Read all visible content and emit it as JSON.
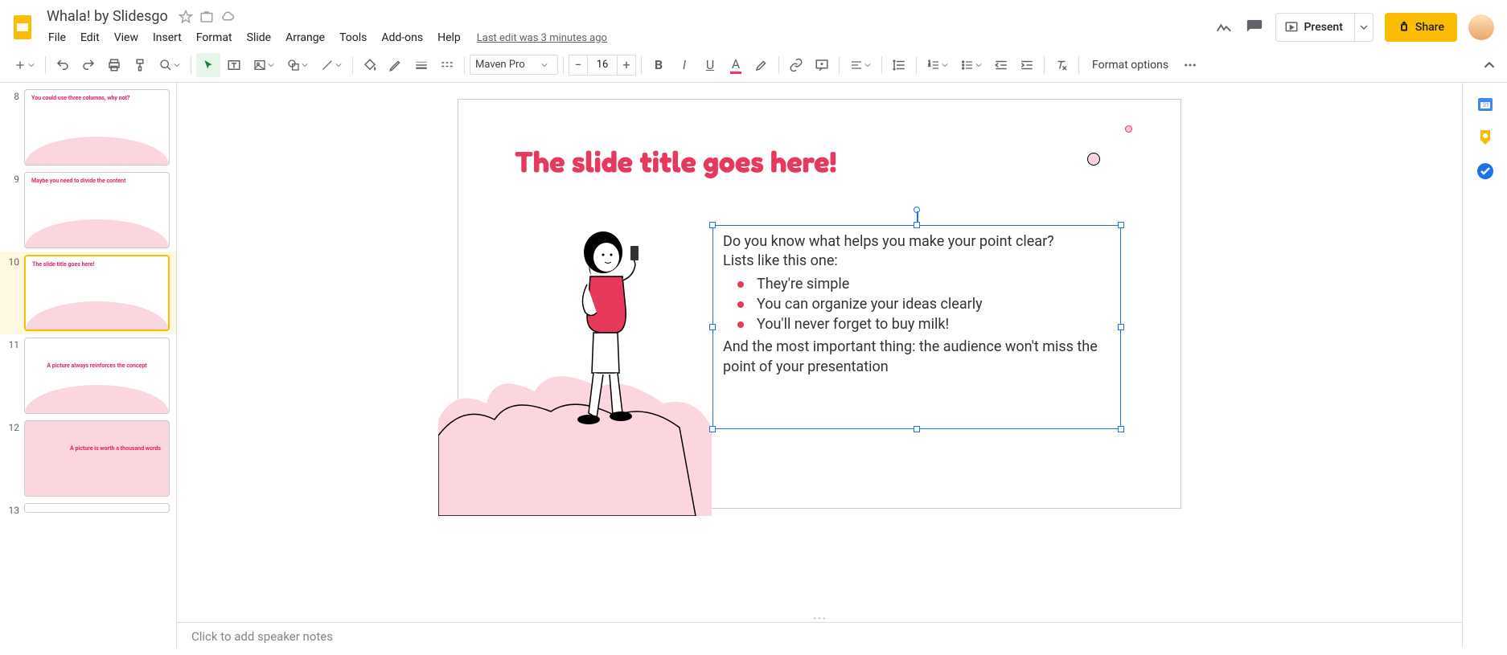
{
  "header": {
    "doc_title": "Whala! by Slidesgo",
    "last_edit": "Last edit was 3 minutes ago",
    "menus": [
      "File",
      "Edit",
      "View",
      "Insert",
      "Format",
      "Slide",
      "Arrange",
      "Tools",
      "Add-ons",
      "Help"
    ],
    "present_label": "Present",
    "share_label": "Share"
  },
  "toolbar": {
    "font_name": "Maven Pro",
    "font_size": "16",
    "format_options": "Format options"
  },
  "filmstrip": {
    "slides": [
      {
        "num": "8",
        "title": "You could use three columns, why not?"
      },
      {
        "num": "9",
        "title": "Maybe you need to divide the content"
      },
      {
        "num": "10",
        "title": "The slide title goes here!"
      },
      {
        "num": "11",
        "title": "A picture always reinforces the concept"
      },
      {
        "num": "12",
        "title": "A picture is worth a thousand words"
      },
      {
        "num": "13",
        "title": ""
      }
    ],
    "selected": 2
  },
  "slide": {
    "title": "The slide title goes here!",
    "body_intro1": "Do you know what helps you make your point clear?",
    "body_intro2": "Lists like this one:",
    "bullets": [
      "They're simple",
      "You can organize your ideas clearly",
      "You'll never forget to buy milk!"
    ],
    "body_outro": "And the most important thing: the audience won't miss the point of your presentation"
  },
  "notes_placeholder": "Click to add speaker notes"
}
